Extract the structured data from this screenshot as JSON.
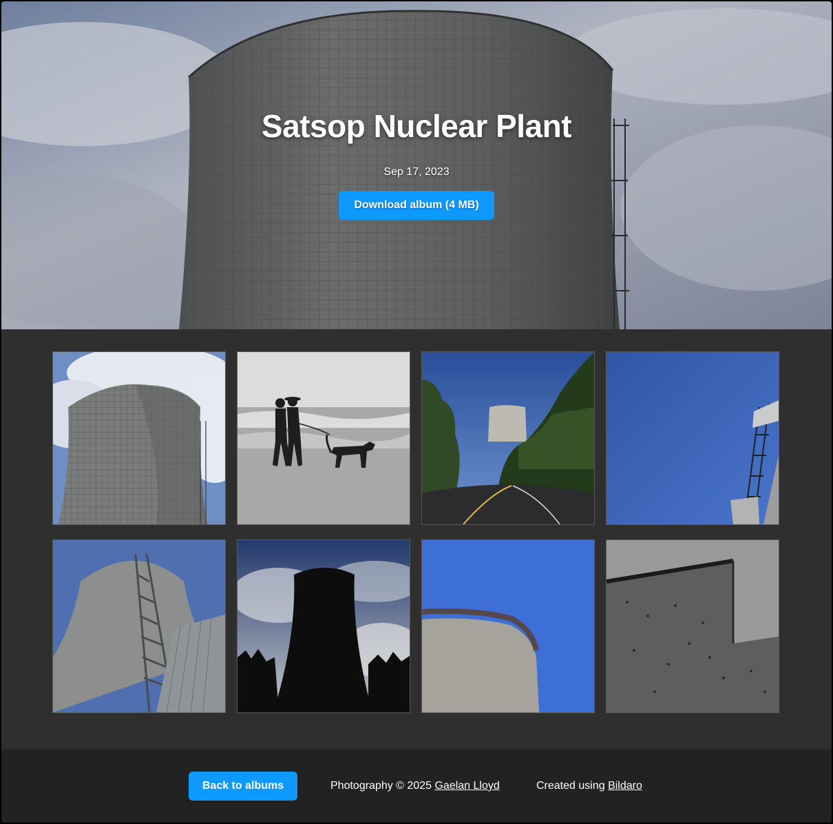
{
  "album": {
    "title": "Satsop Nuclear Plant",
    "date": "Sep 17, 2023",
    "download_label": "Download album (4 MB)"
  },
  "gallery": {
    "photos": [
      {
        "subject": "cooling-tower-clouds"
      },
      {
        "subject": "beach-walkers-dog"
      },
      {
        "subject": "road-tower-trees"
      },
      {
        "subject": "blue-sky-scaffold"
      },
      {
        "subject": "tower-ladder-closeup"
      },
      {
        "subject": "tower-silhouette"
      },
      {
        "subject": "tower-rim-blue-sky"
      },
      {
        "subject": "concrete-wall"
      }
    ]
  },
  "footer": {
    "back_label": "Back to albums",
    "photography_prefix": "Photography © 2025",
    "photographer_name": "Gaelan Lloyd",
    "created_prefix": "Created using",
    "generator_name": "Bildaro"
  },
  "colors": {
    "accent": "#0d99ff",
    "page_background": "#2f2f2f",
    "footer_background": "#222222"
  }
}
